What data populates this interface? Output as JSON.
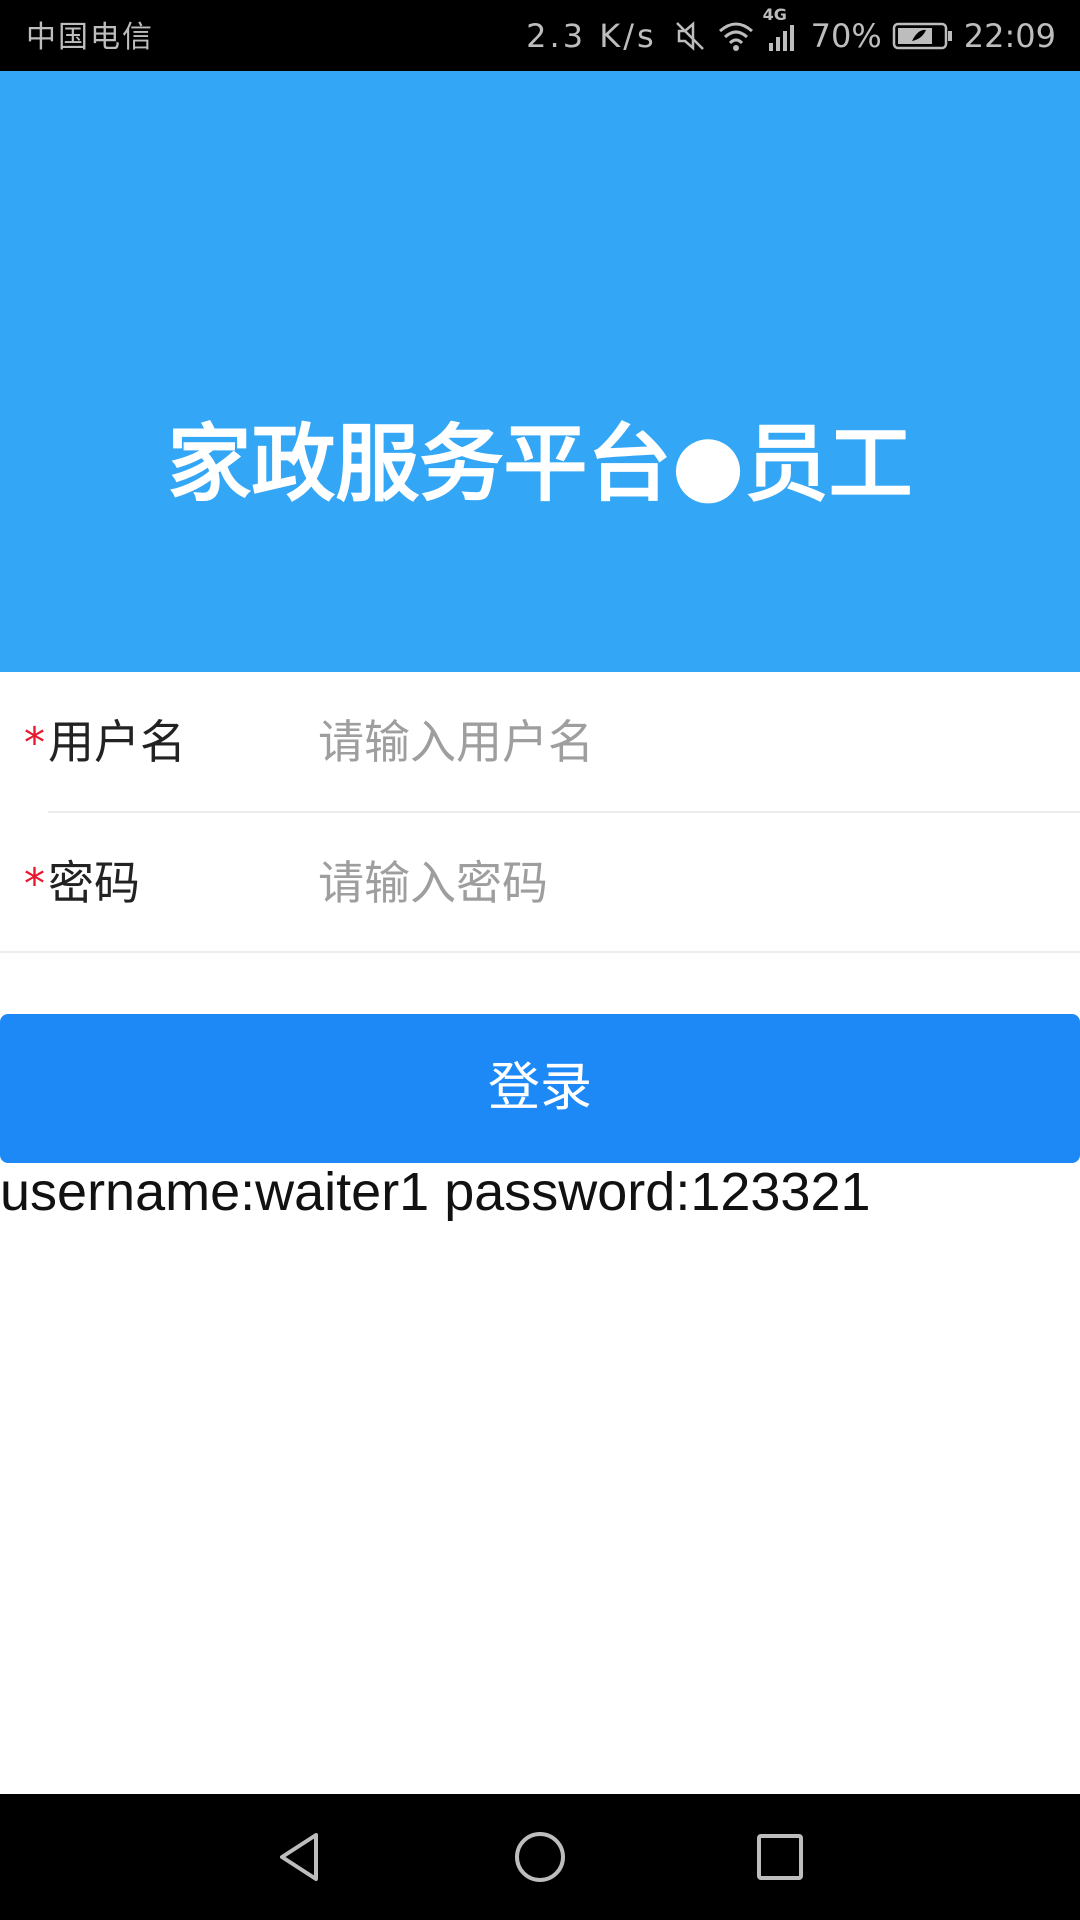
{
  "status_bar": {
    "carrier": "中国电信",
    "net_speed": "2.3 K/s",
    "network_type": "4G",
    "battery": "70%",
    "time": "22:09",
    "icons": [
      "mute-icon",
      "wifi-icon",
      "signal-icon",
      "battery-icon"
    ]
  },
  "header": {
    "title": "家政服务平台●员工",
    "background_color": "#33a6f6"
  },
  "form": {
    "username": {
      "required_mark": "*",
      "label": "用户名",
      "placeholder": "请输入用户名",
      "value": ""
    },
    "password": {
      "required_mark": "*",
      "label": "密码",
      "placeholder": "请输入密码",
      "value": ""
    }
  },
  "login_button": {
    "label": "登录",
    "color": "#1c89f7"
  },
  "hint": "username:waiter1 password:123321",
  "nav_bar": {
    "icons": [
      "back-icon",
      "home-icon",
      "recent-apps-icon"
    ]
  }
}
